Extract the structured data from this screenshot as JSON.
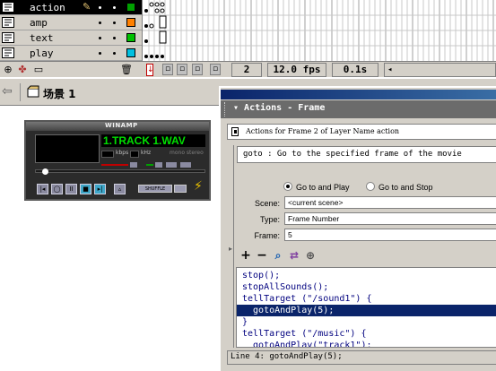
{
  "timeline": {
    "layers": [
      {
        "name": "action",
        "selected": true,
        "color": "#00a000"
      },
      {
        "name": "amp",
        "selected": false,
        "color": "#ff8000"
      },
      {
        "name": "text",
        "selected": false,
        "color": "#00c000"
      },
      {
        "name": "play",
        "selected": false,
        "color": "#00c0e0"
      }
    ],
    "current_frame": "2",
    "frame_rate": "12.0 fps",
    "elapsed_time": "0.1s"
  },
  "scene": {
    "name": "场景 1"
  },
  "winamp": {
    "title": "WINAMP",
    "track": "1.TRACK 1.WAV",
    "kbps_label": "kbps",
    "khz_label": "kHz",
    "mono_stereo": "mono  stereo",
    "shuffle_label": "SHUFFLE"
  },
  "actions": {
    "panel_title": "Actions - Frame",
    "actions_for": "Actions for Frame 2 of Layer Name action",
    "description": "goto : Go to the specified frame of the movie",
    "radio_goto_play": "Go to and Play",
    "radio_goto_stop": "Go to and Stop",
    "scene_label": "Scene:",
    "scene_value": "<current scene>",
    "type_label": "Type:",
    "type_value": "Frame Number",
    "frame_label": "Frame:",
    "frame_value": "5",
    "code_lines": [
      "stop();",
      "stopAllSounds();",
      "tellTarget (\"/sound1\") {",
      "  gotoAndPlay(5);",
      "}",
      "tellTarget (\"/music\") {",
      "  gotoAndPlay(\"track1\");"
    ],
    "highlighted_line": 3,
    "status": "Line 4: gotoAndPlay(5);"
  }
}
